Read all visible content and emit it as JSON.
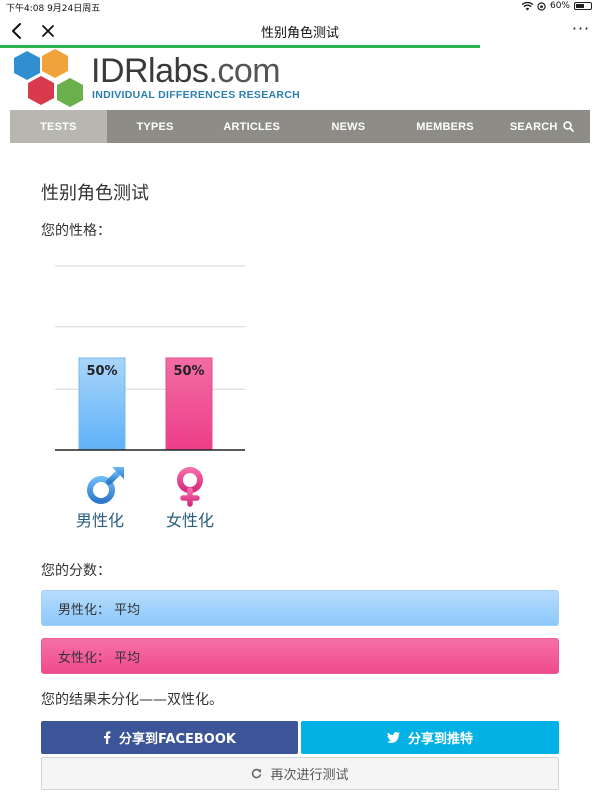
{
  "status": {
    "time_date": "下午4:08   9月24日周五",
    "battery": "60%",
    "battery_level": 0.6
  },
  "nav": {
    "title": "性别角色测试",
    "more": "···"
  },
  "logo": {
    "name": "IDRlabs",
    "suffix": ".com",
    "subtitle": "INDIVIDUAL DIFFERENCES RESEARCH",
    "colors": [
      "#2f8fd0",
      "#f2a23a",
      "#d8394b",
      "#6ab04c"
    ]
  },
  "menu": [
    {
      "label": "TESTS",
      "active": true
    },
    {
      "label": "TYPES",
      "active": false
    },
    {
      "label": "ARTICLES",
      "active": false
    },
    {
      "label": "NEWS",
      "active": false
    },
    {
      "label": "MEMBERS",
      "active": false
    },
    {
      "label": "SEARCH",
      "active": false
    }
  ],
  "content": {
    "title": "性别角色测试",
    "personality_label": "您的性格：",
    "score_label": "您的分数：",
    "conclusion": "您的结果未分化——双性化。"
  },
  "chart_data": {
    "type": "bar",
    "categories": [
      "男性化",
      "女性化"
    ],
    "values": [
      50,
      50
    ],
    "value_labels": [
      "50%",
      "50%"
    ],
    "ylim": [
      0,
      100
    ],
    "grid": true,
    "colors": [
      "#7fc0fa",
      "#f3559b"
    ],
    "category_icons": [
      "male-symbol-icon",
      "female-symbol-icon"
    ]
  },
  "scores": [
    {
      "text": "男性化：  平均"
    },
    {
      "text": "女性化：  平均"
    }
  ],
  "buttons": {
    "facebook": "分享到FACEBOOK",
    "twitter": "分享到推特",
    "retake": "再次进行测试"
  }
}
